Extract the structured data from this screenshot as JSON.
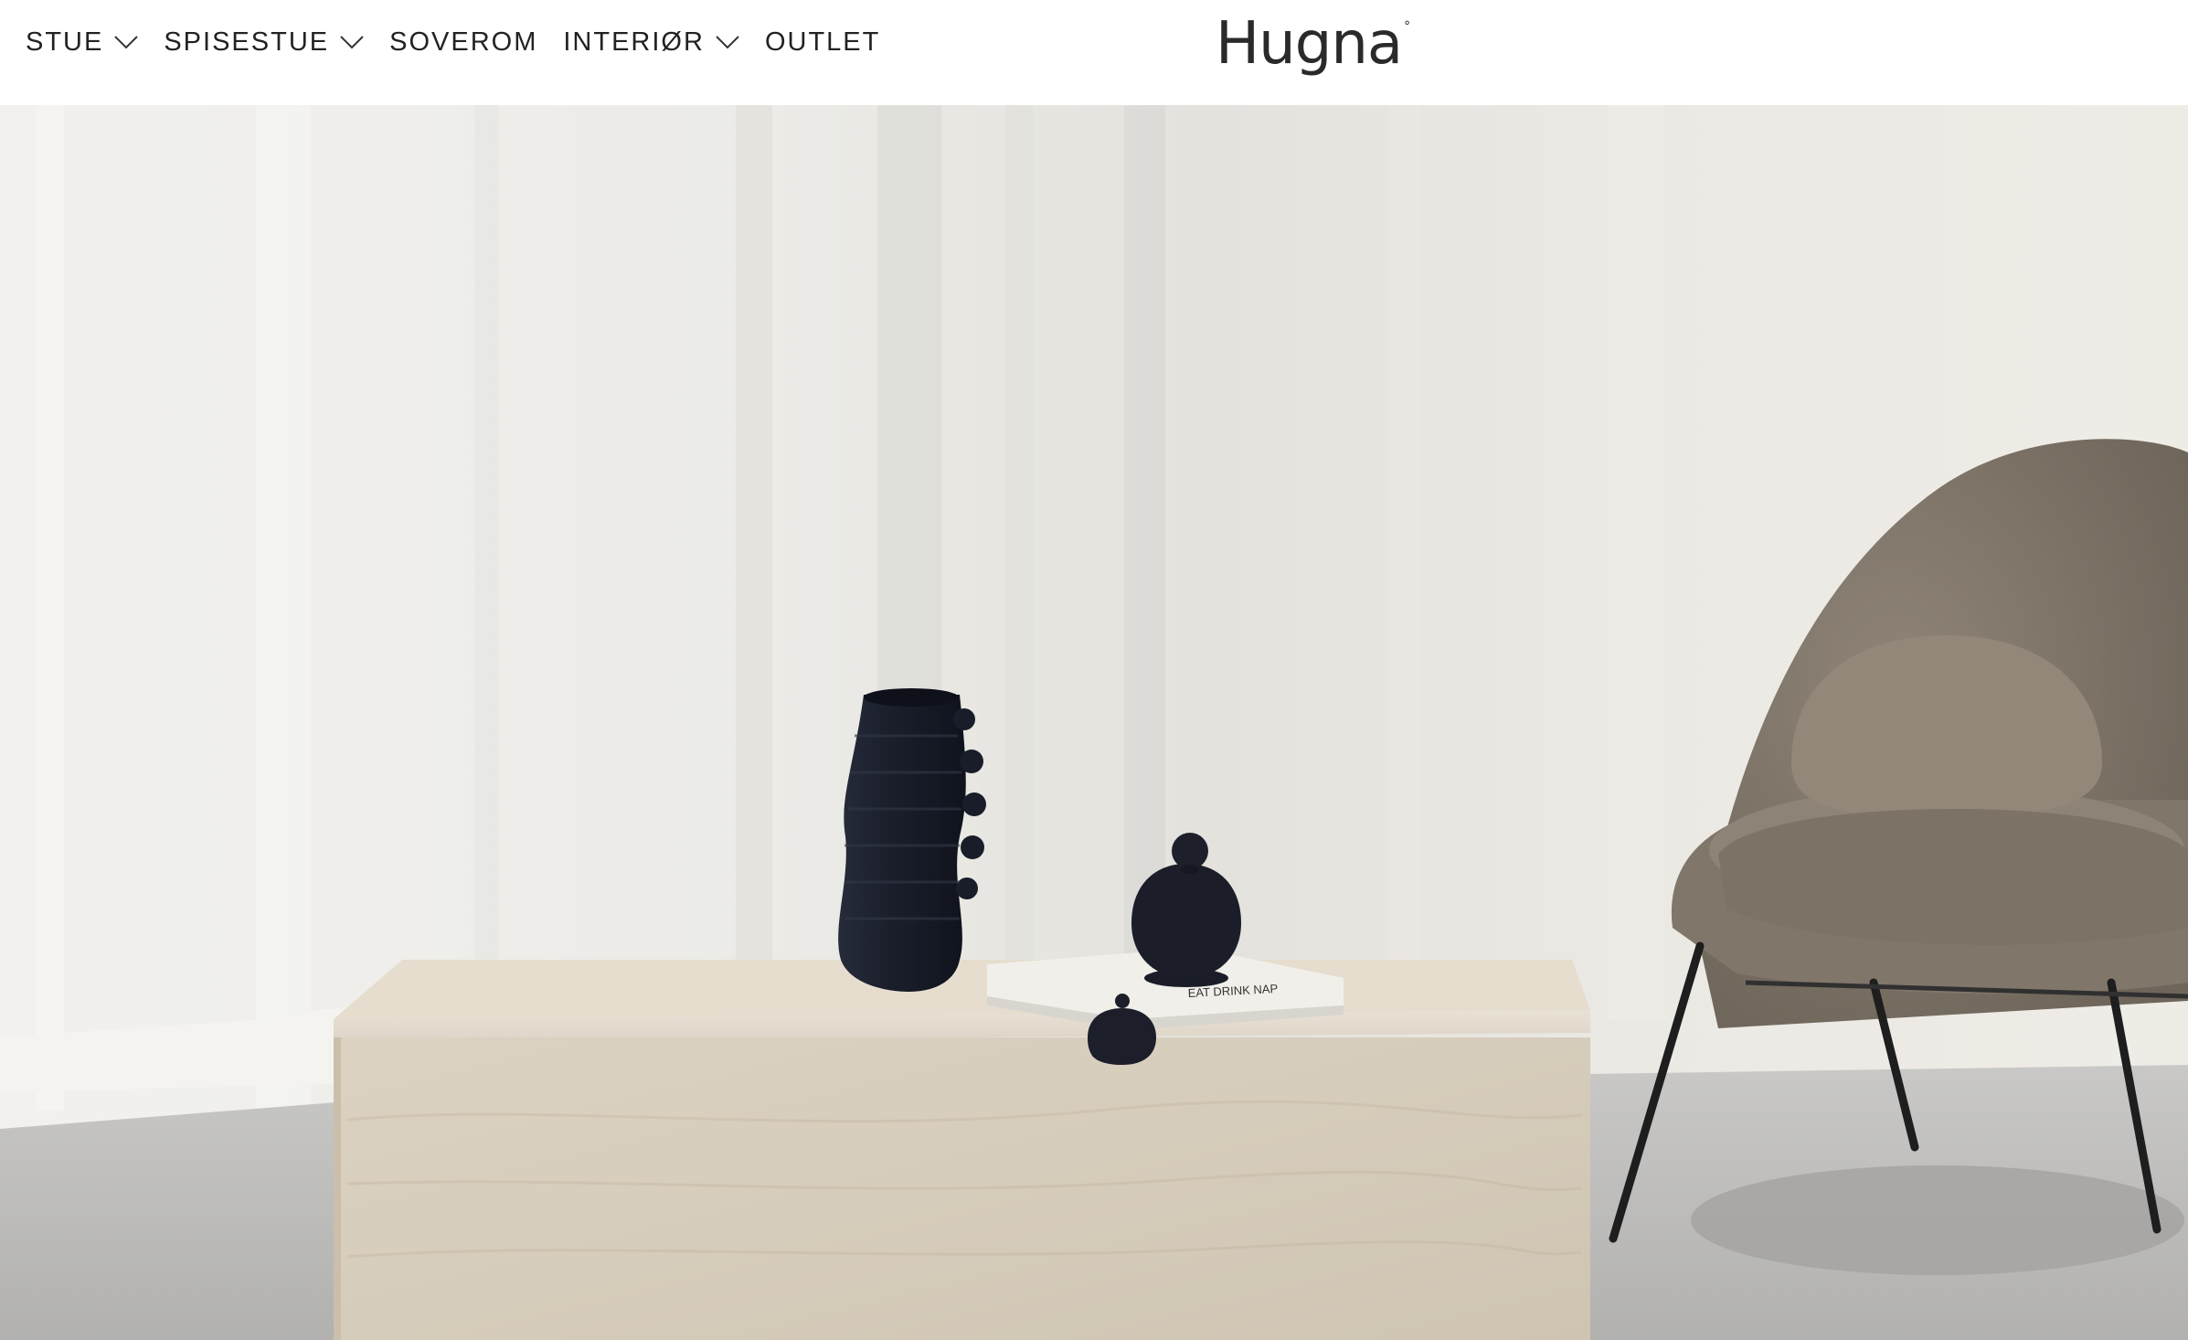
{
  "header": {
    "logo_text": "Hugna",
    "logo_mark": "°",
    "nav": [
      {
        "label": "STUE",
        "has_dropdown": true
      },
      {
        "label": "SPISESTUE",
        "has_dropdown": true
      },
      {
        "label": "SOVEROM",
        "has_dropdown": false
      },
      {
        "label": "INTERIØR",
        "has_dropdown": true
      },
      {
        "label": "OUTLET",
        "has_dropdown": false
      }
    ]
  },
  "hero": {
    "book_title": "EAT DRINK NAP"
  },
  "colors": {
    "text": "#222222",
    "wall": "#ece9e4",
    "floor": "#b9b8b6",
    "travertine": "#ddd3c4",
    "ceramic": "#1b1e28",
    "chair": "#857a6d"
  }
}
